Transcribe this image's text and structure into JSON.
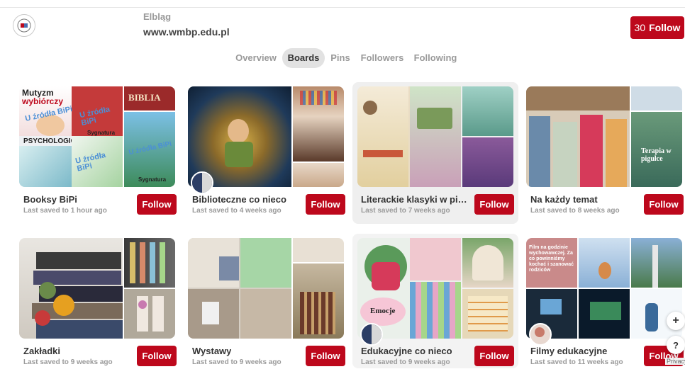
{
  "profile": {
    "city": "Elbląg",
    "url": "www.wmbp.edu.pl",
    "follower_count": "30",
    "follow_label": "Follow"
  },
  "tabs": [
    {
      "label": "Overview",
      "active": false
    },
    {
      "label": "Boards",
      "active": true
    },
    {
      "label": "Pins",
      "active": false
    },
    {
      "label": "Followers",
      "active": false
    },
    {
      "label": "Following",
      "active": false
    }
  ],
  "boards": [
    {
      "title": "Booksy BiPi",
      "saved": "Last saved to 1 hour ago",
      "follow": "Follow",
      "cover": {
        "line1": "Mutyzm",
        "line2": "wybiórczy",
        "watermark": "U źródła BiPi",
        "tag": "Sygnatura",
        "side": "BIBLIA",
        "aspects": "PSYCHOLOGICZNE ASPEKTY"
      }
    },
    {
      "title": "Biblioteczne co nieco",
      "saved": "Last saved to 4 weeks ago",
      "follow": "Follow"
    },
    {
      "title": "Literackie klasyki w pig...",
      "saved": "Last saved to 7 weeks ago",
      "follow": "Follow"
    },
    {
      "title": "Na każdy temat",
      "saved": "Last saved to 8 weeks ago",
      "follow": "Follow",
      "cover": {
        "side": "Terapia w pigułce"
      }
    },
    {
      "title": "Zakładki",
      "saved": "Last saved to 9 weeks ago",
      "follow": "Follow"
    },
    {
      "title": "Wystawy",
      "saved": "Last saved to 9 weeks ago",
      "follow": "Follow"
    },
    {
      "title": "Edukacyjne co nieco",
      "saved": "Last saved to 9 weeks ago",
      "follow": "Follow",
      "cover": {
        "sticker": "Emocje"
      }
    },
    {
      "title": "Filmy edukacyjne",
      "saved": "Last saved to 11 weeks ago",
      "follow": "Follow",
      "cover": {
        "poster": "Film na godzinie wychowawczej. Za co powinniśmy kochać i szanować rodziców"
      }
    }
  ],
  "floating": {
    "plus": "+",
    "help": "?"
  },
  "privacy": "Privacy",
  "colors": {
    "accent": "#bd081c",
    "tab_active_bg": "#e2e2e2",
    "highlight_card": "#efefef"
  }
}
